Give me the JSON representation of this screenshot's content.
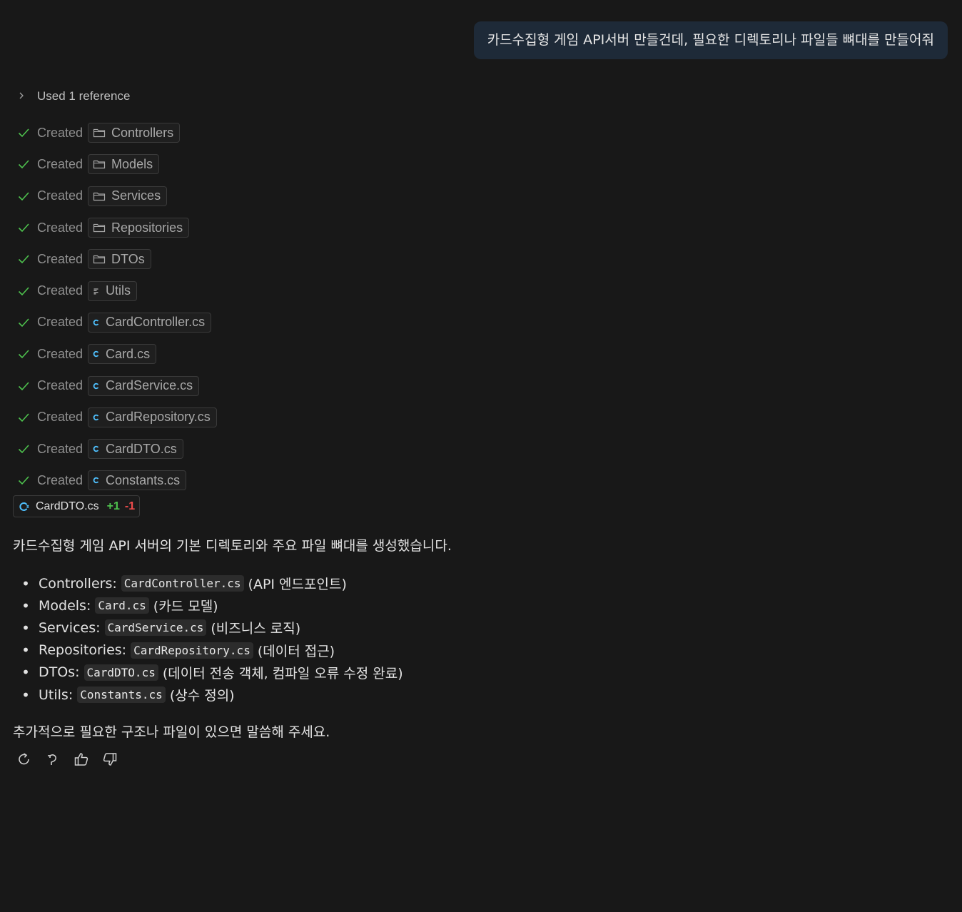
{
  "user_message": "카드수집형 게임 API서버 만들건데, 필요한 디렉토리나 파일들 뼈대를 만들어줘",
  "references": {
    "label": "Used 1 reference",
    "icon": "chevron-right-icon"
  },
  "steps": [
    {
      "verb": "Created",
      "name": "Controllers",
      "icon": "folder-icon"
    },
    {
      "verb": "Created",
      "name": "Models",
      "icon": "folder-icon"
    },
    {
      "verb": "Created",
      "name": "Services",
      "icon": "folder-icon"
    },
    {
      "verb": "Created",
      "name": "Repositories",
      "icon": "folder-icon"
    },
    {
      "verb": "Created",
      "name": "DTOs",
      "icon": "folder-icon"
    },
    {
      "verb": "Created",
      "name": "Utils",
      "icon": "list-icon"
    },
    {
      "verb": "Created",
      "name": "CardController.cs",
      "icon": "csharp-icon"
    },
    {
      "verb": "Created",
      "name": "Card.cs",
      "icon": "csharp-icon"
    },
    {
      "verb": "Created",
      "name": "CardService.cs",
      "icon": "csharp-icon"
    },
    {
      "verb": "Created",
      "name": "CardRepository.cs",
      "icon": "csharp-icon"
    },
    {
      "verb": "Created",
      "name": "CardDTO.cs",
      "icon": "csharp-icon"
    },
    {
      "verb": "Created",
      "name": "Constants.cs",
      "icon": "csharp-icon"
    }
  ],
  "edited_file": {
    "name": "CardDTO.cs",
    "added": "+1",
    "removed": "-1"
  },
  "summary": "카드수집형 게임 API 서버의 기본 디렉토리와 주요 파일 뼈대를 생성했습니다.",
  "file_list": [
    {
      "label": "Controllers:",
      "code": "CardController.cs",
      "desc": "(API 엔드포인트)"
    },
    {
      "label": "Models:",
      "code": "Card.cs",
      "desc": "(카드 모델)"
    },
    {
      "label": "Services:",
      "code": "CardService.cs",
      "desc": "(비즈니스 로직)"
    },
    {
      "label": "Repositories:",
      "code": "CardRepository.cs",
      "desc": "(데이터 접근)"
    },
    {
      "label": "DTOs:",
      "code": "CardDTO.cs",
      "desc": "(데이터 전송 객체, 컴파일 오류 수정 완료)"
    },
    {
      "label": "Utils:",
      "code": "Constants.cs",
      "desc": "(상수 정의)"
    }
  ],
  "bullet": "•",
  "closing": "추가적으로 필요한 구조나 파일이 있으면 말씀해 주세요.",
  "actions": [
    "retry-icon",
    "undo-icon",
    "thumbs-up-icon",
    "thumbs-down-icon"
  ],
  "colors": {
    "background": "#181818",
    "check": "#4ec24e",
    "added": "#4ec24e",
    "removed": "#f14c4c",
    "csharp": "#4fc1ff",
    "user_bubble": "#1e2a38"
  }
}
